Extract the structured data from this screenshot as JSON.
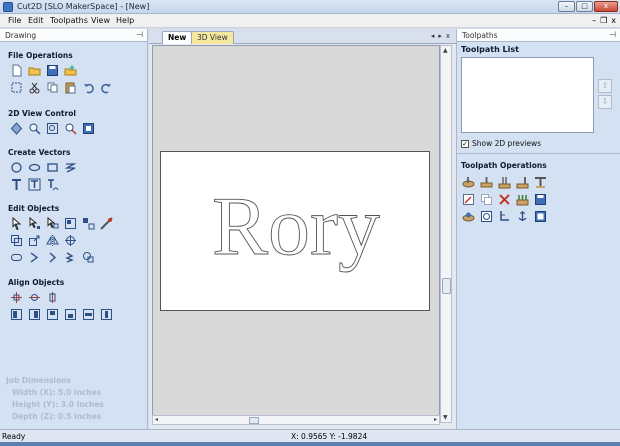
{
  "window": {
    "title": "Cut2D [SLO MakerSpace] - [New]",
    "buttons": {
      "minimize": "–",
      "maximize": "□",
      "close": "x"
    }
  },
  "menubar": {
    "items": [
      "File",
      "Edit",
      "Toolpaths",
      "View",
      "Help"
    ],
    "mdi_controls": [
      "–",
      "❐",
      "x"
    ]
  },
  "left_panel": {
    "title": "Drawing",
    "sections": [
      {
        "title": "File Operations",
        "rows": [
          [
            "new-file-icon",
            "open-folder-icon",
            "save-icon",
            "import-icon"
          ],
          [
            "fit-selection-icon",
            "cut-icon",
            "copy-icon",
            "paste-icon",
            "undo-icon",
            "redo-icon"
          ]
        ]
      },
      {
        "title": "2D View Control",
        "rows": [
          [
            "view-all-icon",
            "zoom-icon",
            "zoom-box-icon",
            "zoom-in-icon",
            "view-fit-icon"
          ]
        ]
      },
      {
        "title": "Create Vectors",
        "rows": [
          [
            "circle-icon",
            "ellipse-icon",
            "rectangle-icon",
            "polyline-icon"
          ],
          [
            "text-icon",
            "text-box-icon",
            "text-arc-icon"
          ]
        ]
      },
      {
        "title": "Edit Objects",
        "rows": [
          [
            "select-icon",
            "node-edit-icon",
            "transform-icon",
            "group-icon",
            "ungroup-icon",
            "measure-icon"
          ],
          [
            "offset-icon",
            "scale-icon",
            "mirror-icon",
            "align-icon"
          ],
          [
            "fillet-icon",
            "trim-icon",
            "extend-icon",
            "join-icon",
            "weld-icon"
          ]
        ]
      },
      {
        "title": "Align Objects",
        "rows": [
          [
            "align-center-icon",
            "align-horizontal-icon",
            "align-vertical-icon"
          ],
          [
            "align-left-icon",
            "align-right-icon",
            "align-top-icon",
            "align-bottom-icon",
            "align-mid-horizontal-icon",
            "align-mid-vertical-icon"
          ]
        ]
      }
    ],
    "job_dimensions": {
      "title": "Job Dimensions",
      "width": "Width  (X): 5.0 inches",
      "height": "Height (Y): 3.0 inches",
      "depth": "Depth  (Z): 0.5 inches"
    }
  },
  "document": {
    "tabs": [
      {
        "label": "New",
        "active": true
      },
      {
        "label": "3D View",
        "active": false
      }
    ],
    "tab_nav": [
      "◂",
      "▸",
      "x"
    ],
    "canvas_text": "Rory"
  },
  "right_panel": {
    "title": "Toolpaths",
    "toolpath_list_title": "Toolpath List",
    "move_up": "⇧",
    "move_down": "⇩",
    "show_previews": "Show 2D previews",
    "show_previews_checked": true,
    "operations_title": "Toolpath Operations",
    "operation_rows": [
      [
        "profile-toolpath-icon",
        "pocket-toolpath-icon",
        "drill-toolpath-icon",
        "inlay-toolpath-icon",
        "vcarve-toolpath-icon"
      ],
      [
        "edit-toolpath-icon",
        "copy-toolpath-icon",
        "delete-toolpath-icon",
        "tabs-icon",
        "save-toolpath-icon"
      ],
      [
        "preview-toolpath-icon",
        "simulate-icon",
        "tool-database-icon",
        "anchor-icon",
        "summary-icon"
      ]
    ]
  },
  "statusbar": {
    "status": "Ready",
    "coords": "X: 0.9565 Y: -1.9824"
  },
  "colors": {
    "panel_bg": "#d4e1f2",
    "section_title": "#0d1a30",
    "job_dims": "#aebad0",
    "tab_other": "#f6e99f"
  }
}
